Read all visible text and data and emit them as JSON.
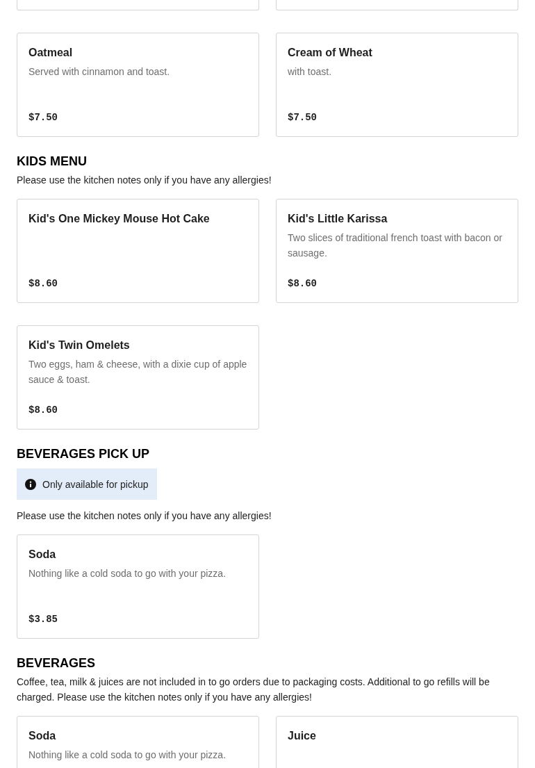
{
  "sections": [
    {
      "items": [
        {
          "name": "Oatmeal",
          "description": "Served with cinnamon and toast.",
          "price": "$7.50"
        },
        {
          "name": "Cream of Wheat",
          "description": "with toast.",
          "price": "$7.50"
        }
      ]
    },
    {
      "title": "KIDS MENU",
      "note": "Please use the kitchen notes only if you have any allergies!",
      "items": [
        {
          "name": "Kid's One Mickey Mouse Hot Cake",
          "price": "$8.60"
        },
        {
          "name": "Kid's Little Karissa",
          "description": "Two slices of traditional french toast with bacon or sausage.",
          "price": "$8.60"
        },
        {
          "name": "Kid's Twin Omelets",
          "description": "Two eggs, ham & cheese, with a dixie cup of apple sauce & toast.",
          "price": "$8.60"
        }
      ]
    },
    {
      "title": "BEVERAGES PICK UP",
      "notice": "Only available for pickup",
      "note": "Please use the kitchen notes only if you have any allergies!",
      "items": [
        {
          "name": "Soda",
          "description": "Nothing like a cold soda to go with your pizza.",
          "price": "$3.85"
        }
      ]
    },
    {
      "title": "BEVERAGES",
      "note": "Coffee, tea, milk & juices are not included in to go orders due to packaging costs. Additional to go refills will be charged. Please use the kitchen notes only if you have any allergies!",
      "items": [
        {
          "name": "Soda",
          "description": "Nothing like a cold soda to go with your pizza."
        },
        {
          "name": "Juice"
        }
      ]
    }
  ]
}
